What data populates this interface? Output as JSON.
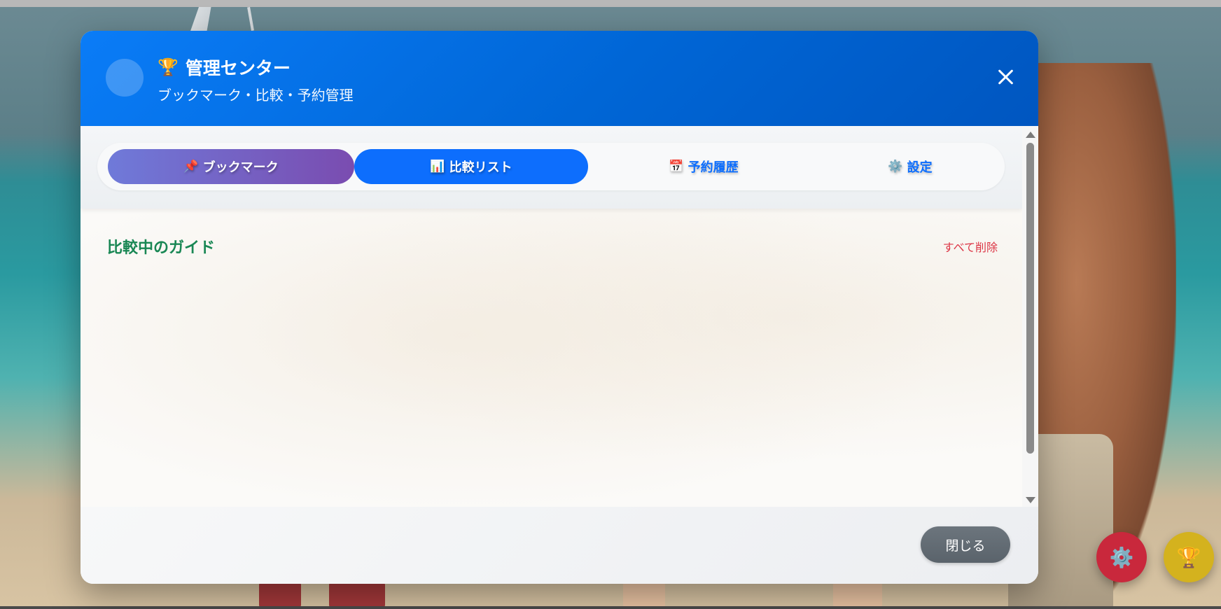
{
  "modal": {
    "title_icon": "🏆",
    "title": "管理センター",
    "subtitle": "ブックマーク・比較・予約管理",
    "close_icon": "close-icon"
  },
  "tabs": [
    {
      "icon": "📌",
      "label": "ブックマーク",
      "active": false
    },
    {
      "icon": "📊",
      "label": "比較リスト",
      "active": true
    },
    {
      "icon": "📅",
      "label": "予約履歴",
      "active": false
    },
    {
      "icon": "⚙️",
      "label": "設定",
      "active": false
    }
  ],
  "compare": {
    "section_title": "比較中のガイド",
    "clear_all_label": "すべて削除"
  },
  "footer": {
    "close_label": "閉じる"
  },
  "fabs": {
    "settings_icon": "⚙️",
    "trophy_icon": "🏆"
  },
  "colors": {
    "header": "#0a7cf7",
    "active_tab": "#0d6efd",
    "bookmark_tab": "#7a4cb0",
    "section_title": "#198754",
    "danger": "#dc3545",
    "fab_settings": "#c9283c",
    "fab_trophy": "#d4b21e"
  }
}
